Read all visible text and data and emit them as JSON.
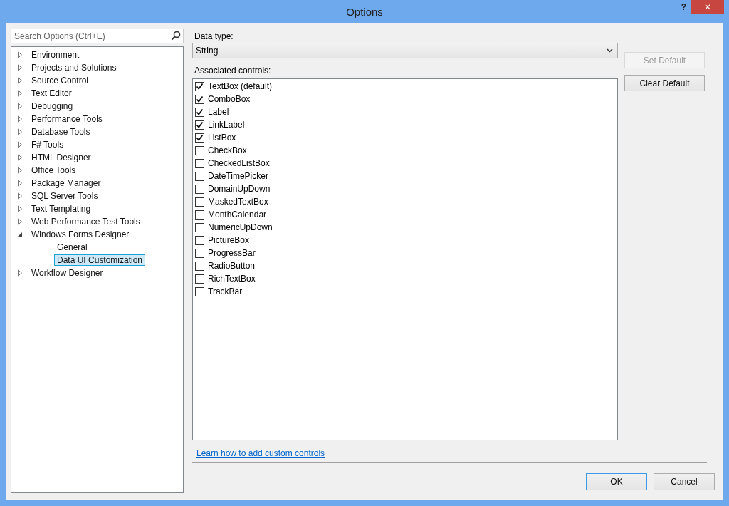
{
  "window": {
    "title": "Options",
    "help": "?",
    "close": "✕"
  },
  "search": {
    "placeholder": "Search Options (Ctrl+E)"
  },
  "tree": [
    {
      "label": "Environment",
      "expanded": false,
      "selected": false
    },
    {
      "label": "Projects and Solutions",
      "expanded": false,
      "selected": false
    },
    {
      "label": "Source Control",
      "expanded": false,
      "selected": false
    },
    {
      "label": "Text Editor",
      "expanded": false,
      "selected": false
    },
    {
      "label": "Debugging",
      "expanded": false,
      "selected": false
    },
    {
      "label": "Performance Tools",
      "expanded": false,
      "selected": false
    },
    {
      "label": "Database Tools",
      "expanded": false,
      "selected": false
    },
    {
      "label": "F# Tools",
      "expanded": false,
      "selected": false
    },
    {
      "label": "HTML Designer",
      "expanded": false,
      "selected": false
    },
    {
      "label": "Office Tools",
      "expanded": false,
      "selected": false
    },
    {
      "label": "Package Manager",
      "expanded": false,
      "selected": false
    },
    {
      "label": "SQL Server Tools",
      "expanded": false,
      "selected": false
    },
    {
      "label": "Text Templating",
      "expanded": false,
      "selected": false
    },
    {
      "label": "Web Performance Test Tools",
      "expanded": false,
      "selected": false
    },
    {
      "label": "Windows Forms Designer",
      "expanded": true,
      "selected": false,
      "children": [
        {
          "label": "General",
          "selected": false
        },
        {
          "label": "Data UI Customization",
          "selected": true
        }
      ]
    },
    {
      "label": "Workflow Designer",
      "expanded": false,
      "selected": false
    }
  ],
  "data_type": {
    "label": "Data type:",
    "value": "String"
  },
  "associated": {
    "label": "Associated controls:",
    "items": [
      {
        "label": "TextBox (default)",
        "checked": true
      },
      {
        "label": "ComboBox",
        "checked": true
      },
      {
        "label": "Label",
        "checked": true
      },
      {
        "label": "LinkLabel",
        "checked": true
      },
      {
        "label": "ListBox",
        "checked": true
      },
      {
        "label": "CheckBox",
        "checked": false
      },
      {
        "label": "CheckedListBox",
        "checked": false
      },
      {
        "label": "DateTimePicker",
        "checked": false
      },
      {
        "label": "DomainUpDown",
        "checked": false
      },
      {
        "label": "MaskedTextBox",
        "checked": false
      },
      {
        "label": "MonthCalendar",
        "checked": false
      },
      {
        "label": "NumericUpDown",
        "checked": false
      },
      {
        "label": "PictureBox",
        "checked": false
      },
      {
        "label": "ProgressBar",
        "checked": false
      },
      {
        "label": "RadioButton",
        "checked": false
      },
      {
        "label": "RichTextBox",
        "checked": false
      },
      {
        "label": "TrackBar",
        "checked": false
      }
    ]
  },
  "side_buttons": [
    {
      "label": "Set Default",
      "disabled": true
    },
    {
      "label": "Clear Default",
      "disabled": false
    }
  ],
  "link": "Learn how to add custom controls",
  "buttons": [
    {
      "label": "OK",
      "default": true
    },
    {
      "label": "Cancel",
      "default": false
    }
  ]
}
